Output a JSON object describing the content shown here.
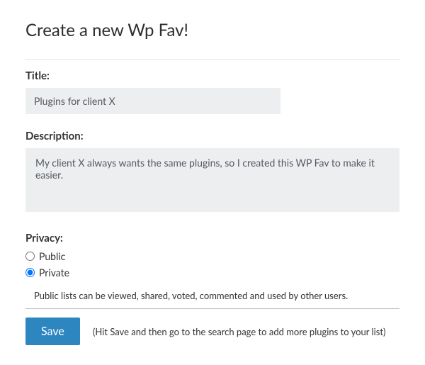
{
  "heading": "Create a new Wp Fav!",
  "fields": {
    "title": {
      "label": "Title:",
      "value": "Plugins for client X"
    },
    "description": {
      "label": "Description:",
      "value": "My client X always wants the same plugins, so I created this WP Fav to make it easier."
    },
    "privacy": {
      "label": "Privacy:",
      "options": {
        "public": "Public",
        "private": "Private"
      },
      "selected": "private",
      "help": "Public lists can be viewed, shared, voted, commented and used by other users."
    }
  },
  "actions": {
    "save_label": "Save",
    "save_hint": "(Hit Save and then go to the search page to add more plugins to your list)"
  }
}
